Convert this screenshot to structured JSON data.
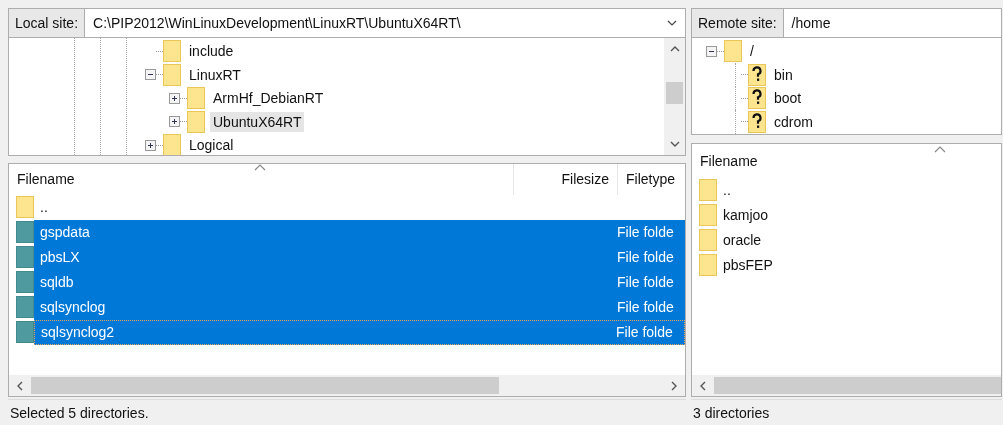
{
  "local": {
    "site_label": "Local site:",
    "path": "C:\\PIP2012\\WinLinuxDevelopment\\LinuxRT\\UbuntuX64RT\\",
    "tree": [
      {
        "label": "include",
        "kind": "leaf",
        "unknown": false,
        "selected": false
      },
      {
        "label": "LinuxRT",
        "kind": "branch",
        "expanded": true,
        "unknown": false,
        "selected": false,
        "children": [
          {
            "label": "ArmHf_DebianRT",
            "kind": "branch",
            "expanded": false,
            "unknown": false,
            "selected": false
          },
          {
            "label": "UbuntuX64RT",
            "kind": "branch",
            "expanded": false,
            "unknown": false,
            "selected": true
          }
        ]
      },
      {
        "label": "Logical",
        "kind": "branch",
        "expanded": false,
        "unknown": false,
        "selected": false
      }
    ],
    "columns": [
      "Filename",
      "Filesize",
      "Filetype"
    ],
    "rows": [
      {
        "name": "..",
        "selected": false,
        "focused": false
      },
      {
        "name": "gspdata",
        "type": "File folde",
        "selected": true,
        "focused": false
      },
      {
        "name": "pbsLX",
        "type": "File folde",
        "selected": true,
        "focused": false
      },
      {
        "name": "sqldb",
        "type": "File folde",
        "selected": true,
        "focused": false
      },
      {
        "name": "sqlsynclog",
        "type": "File folde",
        "selected": true,
        "focused": false
      },
      {
        "name": "sqlsynclog2",
        "type": "File folde",
        "selected": true,
        "focused": true
      }
    ],
    "status": "Selected 5 directories."
  },
  "remote": {
    "site_label": "Remote site:",
    "path": "/home",
    "tree": [
      {
        "label": "/",
        "kind": "branch",
        "expanded": true,
        "unknown": false,
        "selected": false,
        "children": [
          {
            "label": "bin",
            "kind": "leaf",
            "unknown": true,
            "selected": false
          },
          {
            "label": "boot",
            "kind": "leaf",
            "unknown": true,
            "selected": false
          },
          {
            "label": "cdrom",
            "kind": "leaf",
            "unknown": true,
            "selected": false
          }
        ]
      }
    ],
    "columns": [
      "Filename"
    ],
    "rows": [
      {
        "name": "..",
        "selected": false
      },
      {
        "name": "kamjoo",
        "selected": false
      },
      {
        "name": "oracle",
        "selected": false
      },
      {
        "name": "pbsFEP",
        "selected": false
      }
    ],
    "status": "3 directories"
  }
}
